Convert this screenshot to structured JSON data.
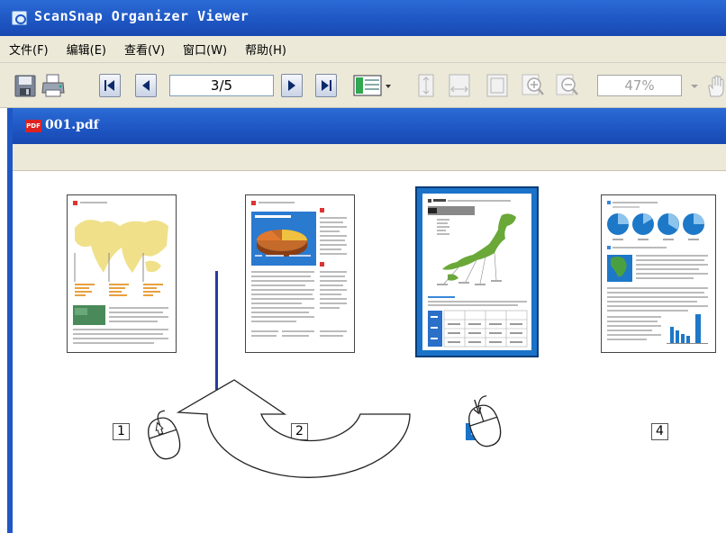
{
  "window": {
    "title": "ScanSnap Organizer Viewer"
  },
  "menu": {
    "items": [
      "文件(F)",
      "编辑(E)",
      "查看(V)",
      "窗口(W)",
      "帮助(H)"
    ]
  },
  "toolbar": {
    "page_indicator": "3/5",
    "zoom": "47%"
  },
  "document": {
    "filename": "001.pdf",
    "pdf_icon_text": "PDF"
  },
  "thumbnails": [
    {
      "number": "1",
      "selected": false
    },
    {
      "number": "2",
      "selected": false
    },
    {
      "number": "3",
      "selected": true
    },
    {
      "number": "4",
      "selected": false
    }
  ]
}
